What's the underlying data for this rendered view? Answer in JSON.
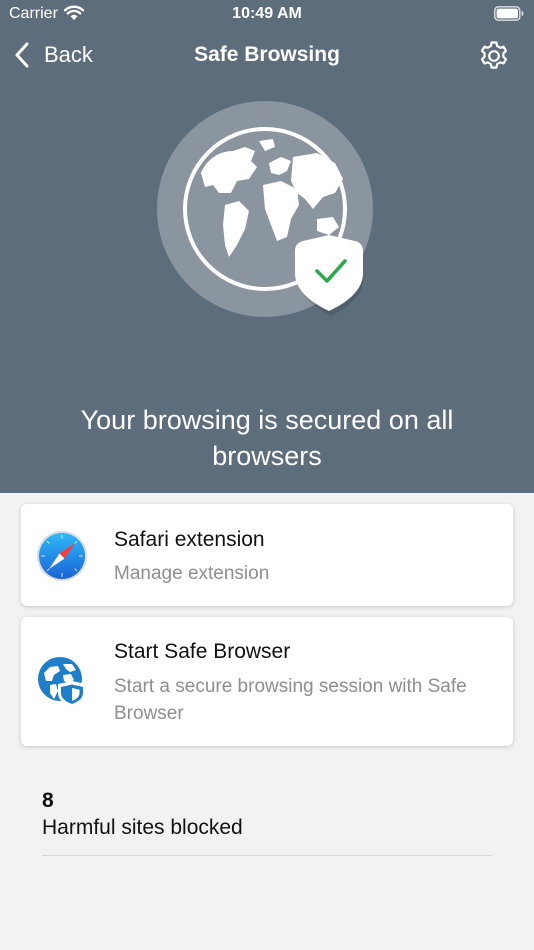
{
  "status_bar": {
    "carrier": "Carrier",
    "time": "10:49 AM"
  },
  "nav": {
    "back_label": "Back",
    "title": "Safe Browsing"
  },
  "hero": {
    "message": "Your browsing is secured on all browsers"
  },
  "cards": [
    {
      "title": "Safari extension",
      "subtitle": "Manage extension",
      "icon": "safari-compass-icon"
    },
    {
      "title": "Start Safe Browser",
      "subtitle": "Start a secure browsing session with Safe Browser",
      "icon": "globe-shield-icon"
    }
  ],
  "stats": {
    "count": "8",
    "label": "Harmful sites blocked"
  },
  "colors": {
    "header_bg": "#5d6d7b",
    "accent_green": "#2fa84f",
    "accent_blue": "#1f7ec8",
    "page_bg": "#f2f2f4"
  }
}
